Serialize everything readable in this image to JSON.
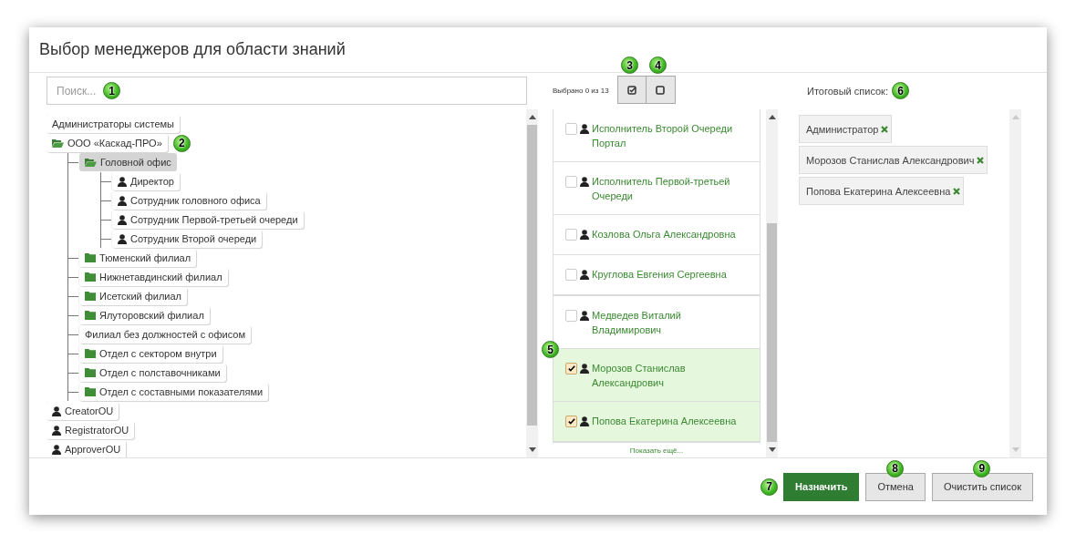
{
  "dialog": {
    "title": "Выбор менеджеров для области знаний"
  },
  "search": {
    "placeholder": "Поиск...",
    "callout": "1"
  },
  "tree": [
    {
      "label": "Администраторы системы",
      "kind": "group",
      "selected": false
    },
    {
      "label": "ООО «Каскад-ПРО»",
      "kind": "folder",
      "expanded": true,
      "selected": false,
      "callout": "2",
      "children": [
        {
          "label": "Головной офис",
          "kind": "folder",
          "expanded": true,
          "selected": true,
          "children": [
            {
              "label": "Директор",
              "kind": "person",
              "selected": false
            },
            {
              "label": "Сотрудник головного офиса",
              "kind": "person",
              "selected": false
            },
            {
              "label": "Сотрудник Первой-третьей очереди",
              "kind": "person",
              "selected": false
            },
            {
              "label": "Сотрудник Второй очереди",
              "kind": "person",
              "selected": false
            }
          ]
        },
        {
          "label": "Тюменский филиал",
          "kind": "folder",
          "expanded": false,
          "selected": false
        },
        {
          "label": "Нижнетавдинский филиал",
          "kind": "folder",
          "expanded": false,
          "selected": false
        },
        {
          "label": "Исетский филиал",
          "kind": "folder",
          "expanded": false,
          "selected": false
        },
        {
          "label": "Ялуторовский филиал",
          "kind": "folder",
          "expanded": false,
          "selected": false
        },
        {
          "label": "Филиал без должностей с офисом",
          "kind": "group",
          "selected": false
        },
        {
          "label": "Отдел с сектором внутри",
          "kind": "folder",
          "expanded": false,
          "selected": false
        },
        {
          "label": "Отдел с полставочниками",
          "kind": "folder",
          "expanded": false,
          "selected": false
        },
        {
          "label": "Отдел с составными показателями",
          "kind": "folder",
          "expanded": false,
          "selected": false
        }
      ]
    },
    {
      "label": "CreatorOU",
      "kind": "person",
      "selected": false
    },
    {
      "label": "RegistratorOU",
      "kind": "person",
      "selected": false
    },
    {
      "label": "ApproverOU",
      "kind": "person",
      "selected": false
    }
  ],
  "selection": {
    "counter": "Выбрано 0 из 13",
    "select_all_callout": "3",
    "deselect_all_callout": "4",
    "list_callout": "5"
  },
  "people": [
    {
      "name": "Исполнитель Второй Очереди Портал",
      "checked": false
    },
    {
      "name": "Исполнитель Первой-третьей Очереди",
      "checked": false
    },
    {
      "name": "Козлова Ольга Александровна",
      "checked": false
    },
    {
      "name": "Круглова Евгения Сергеевна",
      "checked": false
    },
    {
      "name": "Медведев Виталий Владимирович",
      "checked": false
    },
    {
      "name": "Морозов Станислав Александрович",
      "checked": true
    },
    {
      "name": "Попова Екатерина Алексеевна",
      "checked": true
    }
  ],
  "show_more": "Показать ещё...",
  "final_list": {
    "label": "Итоговый список:",
    "callout": "6",
    "items": [
      "Администратор",
      "Морозов Станислав Александрович",
      "Попова Екатерина Алексеевна"
    ]
  },
  "buttons": [
    {
      "label": "Назначить",
      "kind": "primary",
      "callout": "7"
    },
    {
      "label": "Отмена",
      "kind": "default",
      "callout": "8"
    },
    {
      "label": "Очистить список",
      "kind": "default",
      "callout": "9"
    }
  ]
}
